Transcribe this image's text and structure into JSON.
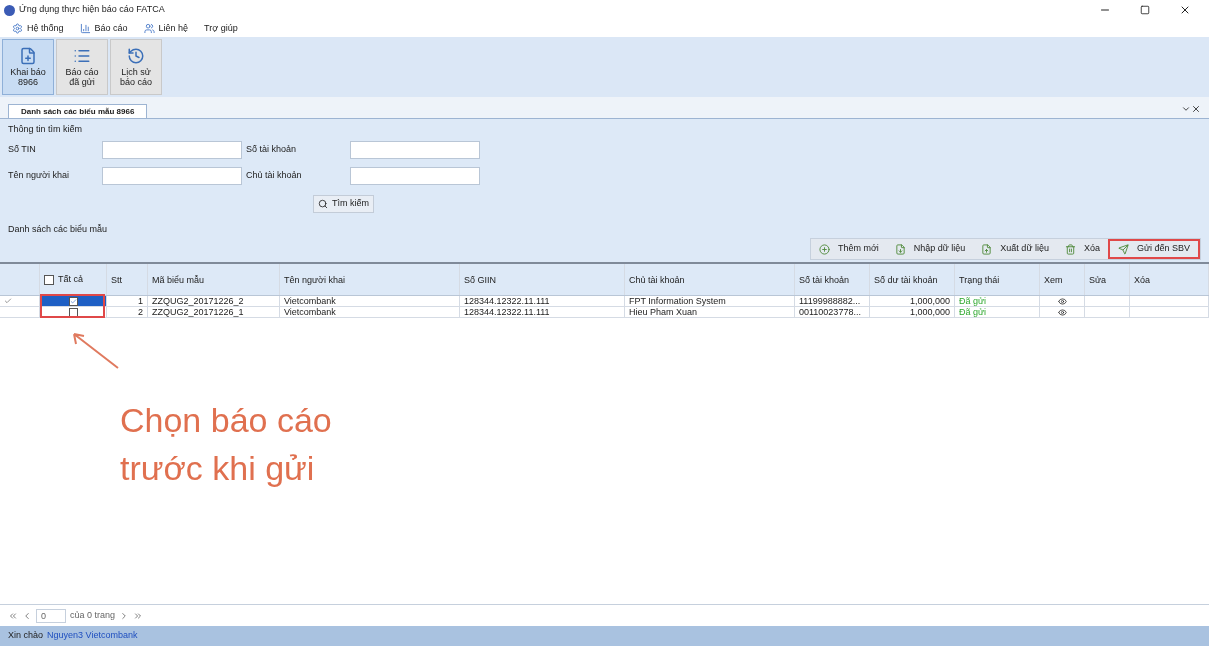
{
  "window": {
    "title": "Ứng dụng thực hiện báo cáo FATCA"
  },
  "menu": [
    {
      "label": "Hệ thống"
    },
    {
      "label": "Báo cáo"
    },
    {
      "label": "Liên hệ"
    },
    {
      "label": "Trợ giúp"
    }
  ],
  "ribbon": [
    {
      "lines": [
        "Khai báo",
        "8966"
      ],
      "selected": true
    },
    {
      "lines": [
        "Báo cáo",
        "đã gửi"
      ],
      "selected": false
    },
    {
      "lines": [
        "Lịch sử",
        "báo cáo"
      ],
      "selected": false
    }
  ],
  "document_tab": {
    "title": "Danh sách các biểu mẫu 8966"
  },
  "search": {
    "title": "Thông tin tìm kiếm",
    "fields": [
      {
        "label": "Số TIN"
      },
      {
        "label": "Số tài khoản"
      },
      {
        "label": "Tên người khai"
      },
      {
        "label": "Chủ tài khoản"
      }
    ],
    "button": "Tìm kiếm"
  },
  "list_title": "Danh sách các biểu mẫu",
  "toolbar": [
    {
      "label": "Thêm mới",
      "highlighted": false
    },
    {
      "label": "Nhập dữ liệu",
      "highlighted": false
    },
    {
      "label": "Xuất dữ liệu",
      "highlighted": false
    },
    {
      "label": "Xóa",
      "highlighted": false
    },
    {
      "label": "Gửi đến SBV",
      "highlighted": true
    }
  ],
  "table": {
    "select_all": {
      "label": "Tất cả",
      "checked": false
    },
    "columns": [
      "Stt",
      "Mã biểu mẫu",
      "Tên người khai",
      "Số GIIN",
      "Chủ tài khoản",
      "Số tài khoản",
      "Số dư tài khoản",
      "Trạng thái",
      "Xem",
      "Sửa",
      "Xóa"
    ],
    "rows": [
      {
        "selected": true,
        "checked": true,
        "stt": "1",
        "code": "ZZQUG2_20171226_2",
        "filer": "Vietcombank",
        "giin": "128344.12322.11.111",
        "owner": "FPT Information System",
        "account": "11199988882...",
        "balance": "1,000,000",
        "status": "Đã gửi"
      },
      {
        "selected": false,
        "checked": false,
        "stt": "2",
        "code": "ZZQUG2_20171226_1",
        "filer": "Vietcombank",
        "giin": "128344.12322.11.111",
        "owner": "Hieu Pham Xuan",
        "account": "00110023778...",
        "balance": "1,000,000",
        "status": "Đã gửi"
      }
    ]
  },
  "annotation": {
    "lines": [
      "Chọn báo cáo",
      "trước khi gửi"
    ]
  },
  "pager": {
    "page": "0",
    "of": "của 0 trang"
  },
  "status_bar": {
    "greeting": "Xin chào",
    "user": "Nguyen3 Vietcombank"
  }
}
